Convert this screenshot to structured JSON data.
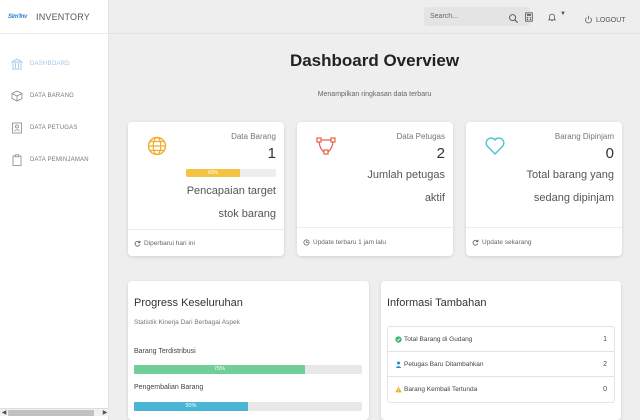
{
  "sidebar": {
    "brand_logo": "Sim'Inv",
    "brand_title": "INVENTORY",
    "items": [
      {
        "label": "DASHBOARD",
        "icon": "bank-icon"
      },
      {
        "label": "DATA BARANG",
        "icon": "box-icon"
      },
      {
        "label": "DATA PETUGAS",
        "icon": "id-card-icon"
      },
      {
        "label": "DATA PEMINJAMAN",
        "icon": "clipboard-icon"
      }
    ]
  },
  "topbar": {
    "search_placeholder": "Search...",
    "logout_label": "LOGOUT"
  },
  "header": {
    "title": "Dashboard Overview",
    "subtitle": "Menampilkan ringkasan data terbaru"
  },
  "stats": [
    {
      "label": "Data Barang",
      "value": "1",
      "progress_label": "60%",
      "progress": 60,
      "desc_lines": [
        "Pencapaian target",
        "stok barang"
      ],
      "footer": "Diperbarui hari ini",
      "color": "#f0ad2b"
    },
    {
      "label": "Data Petugas",
      "value": "2",
      "desc_lines": [
        "Jumlah petugas",
        "aktif"
      ],
      "footer": "Update terbaru 1 jam lalu",
      "color": "#e8604a"
    },
    {
      "label": "Barang Dipinjam",
      "value": "0",
      "desc_lines": [
        "Total barang yang",
        "sedang dipinjam"
      ],
      "footer": "Update sekarang",
      "color": "#4fc3d6"
    }
  ],
  "progress_panel": {
    "title": "Progress Keseluruhan",
    "subtitle": "Statistik Kinerja Dari Berbagai Aspek",
    "bars": [
      {
        "label": "Barang Terdistribusi",
        "value_label": "75%",
        "value": 75,
        "color": "#6fcf97"
      },
      {
        "label": "Pengembalian Barang",
        "value_label": "50%",
        "value": 50,
        "color": "#4bb5d6"
      }
    ]
  },
  "info_panel": {
    "title": "Informasi Tambahan",
    "rows": [
      {
        "label": "Total Barang di Gudang",
        "count": "1",
        "icon": "check-circle-icon",
        "color": "#3cb371"
      },
      {
        "label": "Petugas Baru Ditambahkan",
        "count": "2",
        "icon": "user-icon",
        "color": "#2f8fd0"
      },
      {
        "label": "Barang Kembali Tertunda",
        "count": "0",
        "icon": "warning-icon",
        "color": "#f0ad2b"
      }
    ]
  }
}
